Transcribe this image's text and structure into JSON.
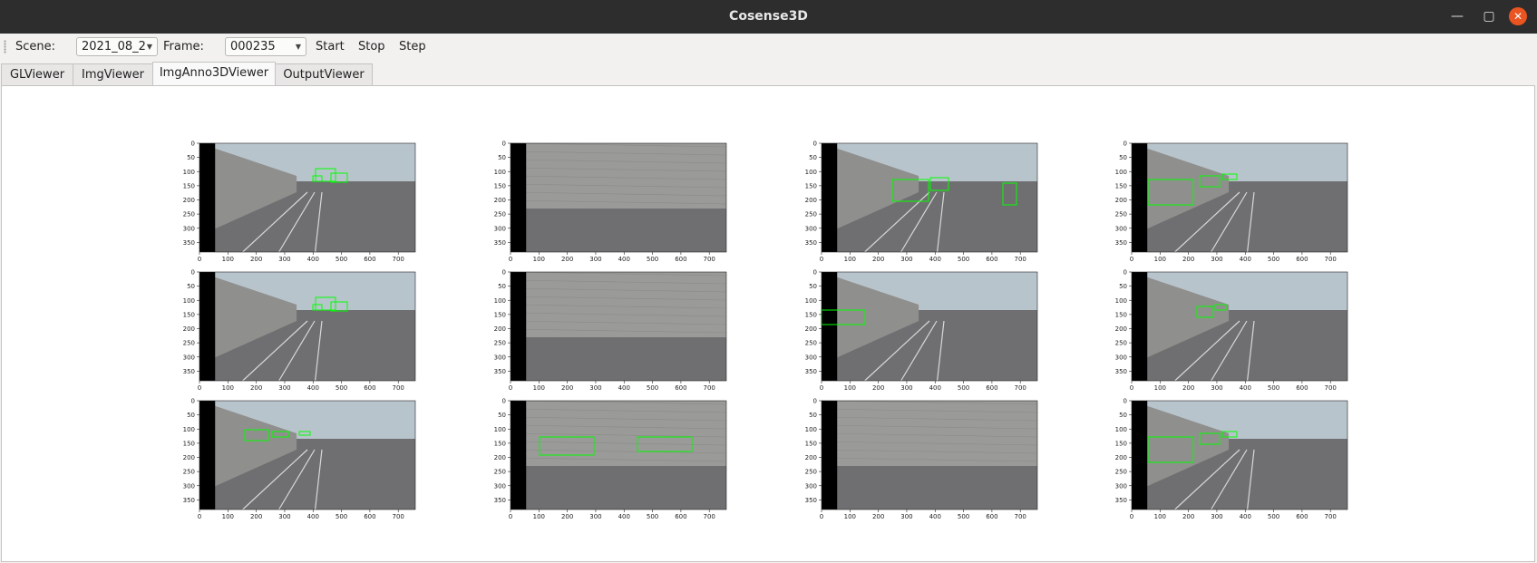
{
  "window": {
    "title": "Cosense3D",
    "minimize_icon": "minimize-icon",
    "maximize_icon": "maximize-icon",
    "close_icon": "close-icon"
  },
  "toolbar": {
    "scene_label": "Scene:",
    "scene_value": "2021_08_2",
    "frame_label": "Frame:",
    "frame_value": "000235",
    "start_label": "Start",
    "stop_label": "Stop",
    "step_label": "Step"
  },
  "tabs": [
    {
      "label": "GLViewer",
      "active": false
    },
    {
      "label": "ImgViewer",
      "active": false
    },
    {
      "label": "ImgAnno3DViewer",
      "active": true
    },
    {
      "label": "OutputViewer",
      "active": false
    }
  ],
  "axes": {
    "y_ticks": [
      "0",
      "50",
      "100",
      "150",
      "200",
      "250",
      "300",
      "350"
    ],
    "x_ticks": [
      "0",
      "100",
      "200",
      "300",
      "400",
      "500",
      "600",
      "700"
    ]
  },
  "colors": {
    "box_green": "#00ff00",
    "titlebar": "#2d2d2d",
    "close_button": "#e95420"
  },
  "images": [
    {
      "scene": "road-wall-left"
    },
    {
      "scene": "wall-closeup"
    },
    {
      "scene": "bridge-cars"
    },
    {
      "scene": "road-trees-cars"
    },
    {
      "scene": "road-wall-left"
    },
    {
      "scene": "wall-closeup"
    },
    {
      "scene": "overpass-barrier"
    },
    {
      "scene": "road-wall-right"
    },
    {
      "scene": "road-overpass"
    },
    {
      "scene": "wall-near-cars"
    },
    {
      "scene": "wall-snow"
    },
    {
      "scene": "road-trees-cars"
    }
  ]
}
